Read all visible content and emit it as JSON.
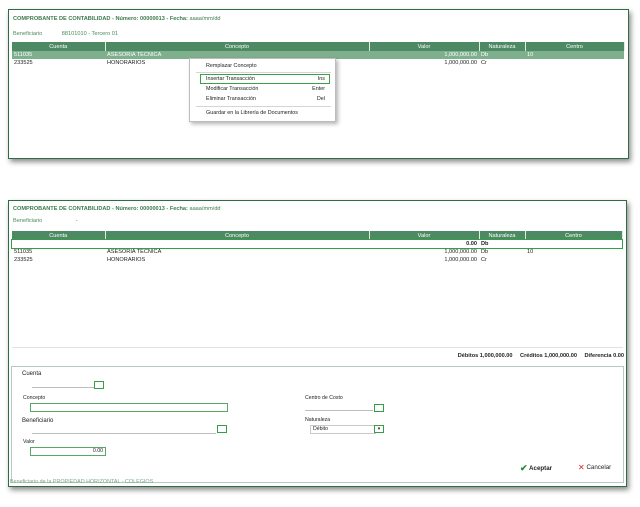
{
  "header": {
    "title": "COMPROBANTE DE CONTABILIDAD - Número: 00000013 - Fecha:",
    "date": "aaaa/mm/dd"
  },
  "panel1": {
    "beneficiario_label": "Beneficiario",
    "beneficiario_value": "88101010 - Tercero 01"
  },
  "panel2": {
    "beneficiario_label": "Beneficiario",
    "beneficiario_value": "-"
  },
  "columns": [
    "Cuenta",
    "Concepto",
    "Valor",
    "Naturaleza",
    "Centro"
  ],
  "rows1": [
    {
      "cuenta": "511035",
      "concepto": "ASESORIA TECNICA",
      "valor": "1,000,000.00",
      "naturaleza": "Db",
      "centro": "10"
    },
    {
      "cuenta": "233525",
      "concepto": "HONORARIOS",
      "valor": "1,000,000.00",
      "naturaleza": "Cr",
      "centro": ""
    }
  ],
  "new_row": {
    "valor": "0.00",
    "naturaleza": "Db"
  },
  "rows2": [
    {
      "cuenta": "511035",
      "concepto": "ASESORIA TECNICA",
      "valor": "1,000,000.00",
      "naturaleza": "Db",
      "centro": "10"
    },
    {
      "cuenta": "233525",
      "concepto": "HONORARIOS",
      "valor": "1,000,000.00",
      "naturaleza": "Cr",
      "centro": ""
    }
  ],
  "context_menu": {
    "replace": "Remplazar Concepto",
    "insert": "Insertar Transacción",
    "insert_sc": "Ins",
    "modify": "Modificar Transacción",
    "modify_sc": "Enter",
    "delete": "Eliminar Transacción",
    "delete_sc": "Del",
    "save": "Guardar en la Librería de Documentos"
  },
  "totals": {
    "debitos": "Débitos 1,000,000.00",
    "creditos": "Créditos 1,000,000.00",
    "diferencia": "Diferencia 0.00"
  },
  "form": {
    "cuenta_label": "Cuenta",
    "concepto_label": "Concepto",
    "beneficiario_label": "Beneficiario",
    "valor_label": "Valor",
    "valor_value": "0.00",
    "centro_label": "Centro de Costo",
    "naturaleza_label": "Naturaleza",
    "naturaleza_value": "Débito",
    "accept": "Aceptar",
    "cancel": "Cancelar"
  },
  "footer_cut": "Beneficiario de la PROPIEDAD HORIZONTAL - COLEGIOS",
  "colors": {
    "accent": "#4d8a64",
    "highlight": "#33a046"
  }
}
